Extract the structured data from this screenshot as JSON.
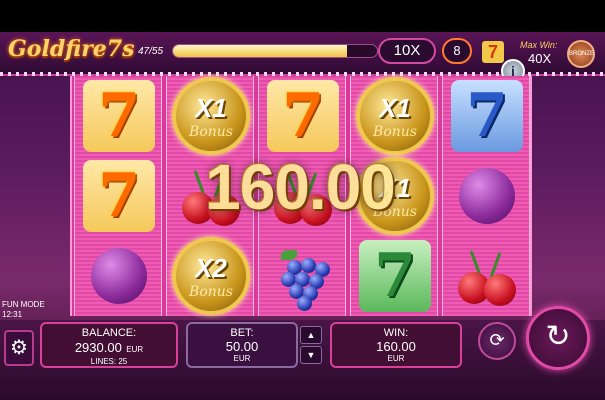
{
  "game": {
    "logo": "Goldfire7s"
  },
  "header": {
    "progress_label": "47/55",
    "progress_fraction": 0.855,
    "multiplier_label": "10X",
    "spins_count": "8",
    "seven_symbol": "7",
    "max_win_label": "Max Win:",
    "max_win_value": "40X",
    "badge_label": "BRONZE",
    "info_label": "i"
  },
  "reels": [
    {
      "cells": [
        {
          "type": "seven",
          "label": "7"
        },
        {
          "type": "seven",
          "label": "7"
        },
        {
          "type": "plum"
        }
      ]
    },
    {
      "cells": [
        {
          "type": "bonus",
          "mult": "X1",
          "text": "Bonus"
        },
        {
          "type": "cherries"
        },
        {
          "type": "bonus",
          "mult": "X2",
          "text": "Bonus"
        }
      ]
    },
    {
      "cells": [
        {
          "type": "seven",
          "label": "7"
        },
        {
          "type": "cherries"
        },
        {
          "type": "grapes"
        }
      ]
    },
    {
      "cells": [
        {
          "type": "bonus",
          "mult": "X1",
          "text": "Bonus"
        },
        {
          "type": "bonus",
          "mult": "X1",
          "text": "Bonus"
        },
        {
          "type": "seven-green",
          "label": "7"
        }
      ]
    },
    {
      "cells": [
        {
          "type": "seven-blue",
          "label": "7"
        },
        {
          "type": "plum"
        },
        {
          "type": "cherries"
        }
      ]
    }
  ],
  "win_overlay": "160.00",
  "status": {
    "mode": "FUN MODE",
    "clock": "12:31"
  },
  "footer": {
    "settings_icon": "⚙",
    "balance_label": "BALANCE:",
    "balance_value": "2930.00",
    "balance_currency": "EUR",
    "lines_label": "LINES: 25",
    "bet_label": "BET:",
    "bet_value": "50.00",
    "bet_currency": "EUR",
    "bet_up": "▲",
    "bet_down": "▼",
    "win_label": "WIN:",
    "win_value": "160.00",
    "win_currency": "EUR",
    "autoplay_icon": "⟳",
    "spin_icon": "↻"
  },
  "colors": {
    "accent": "#d8409a",
    "gold": "#ffe89a"
  }
}
